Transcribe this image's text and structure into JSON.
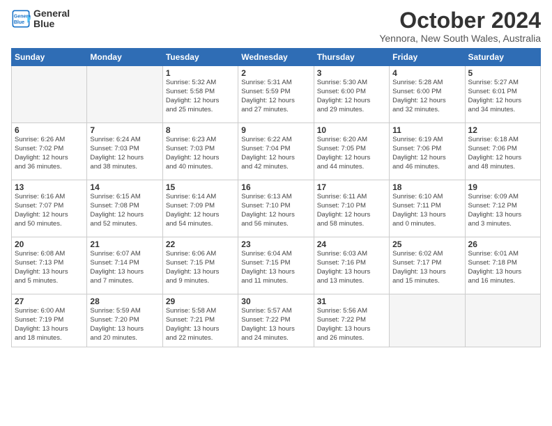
{
  "logo": {
    "line1": "General",
    "line2": "Blue"
  },
  "title": "October 2024",
  "location": "Yennora, New South Wales, Australia",
  "days_of_week": [
    "Sunday",
    "Monday",
    "Tuesday",
    "Wednesday",
    "Thursday",
    "Friday",
    "Saturday"
  ],
  "weeks": [
    [
      {
        "day": "",
        "info": ""
      },
      {
        "day": "",
        "info": ""
      },
      {
        "day": "1",
        "info": "Sunrise: 5:32 AM\nSunset: 5:58 PM\nDaylight: 12 hours\nand 25 minutes."
      },
      {
        "day": "2",
        "info": "Sunrise: 5:31 AM\nSunset: 5:59 PM\nDaylight: 12 hours\nand 27 minutes."
      },
      {
        "day": "3",
        "info": "Sunrise: 5:30 AM\nSunset: 6:00 PM\nDaylight: 12 hours\nand 29 minutes."
      },
      {
        "day": "4",
        "info": "Sunrise: 5:28 AM\nSunset: 6:00 PM\nDaylight: 12 hours\nand 32 minutes."
      },
      {
        "day": "5",
        "info": "Sunrise: 5:27 AM\nSunset: 6:01 PM\nDaylight: 12 hours\nand 34 minutes."
      }
    ],
    [
      {
        "day": "6",
        "info": "Sunrise: 6:26 AM\nSunset: 7:02 PM\nDaylight: 12 hours\nand 36 minutes."
      },
      {
        "day": "7",
        "info": "Sunrise: 6:24 AM\nSunset: 7:03 PM\nDaylight: 12 hours\nand 38 minutes."
      },
      {
        "day": "8",
        "info": "Sunrise: 6:23 AM\nSunset: 7:03 PM\nDaylight: 12 hours\nand 40 minutes."
      },
      {
        "day": "9",
        "info": "Sunrise: 6:22 AM\nSunset: 7:04 PM\nDaylight: 12 hours\nand 42 minutes."
      },
      {
        "day": "10",
        "info": "Sunrise: 6:20 AM\nSunset: 7:05 PM\nDaylight: 12 hours\nand 44 minutes."
      },
      {
        "day": "11",
        "info": "Sunrise: 6:19 AM\nSunset: 7:06 PM\nDaylight: 12 hours\nand 46 minutes."
      },
      {
        "day": "12",
        "info": "Sunrise: 6:18 AM\nSunset: 7:06 PM\nDaylight: 12 hours\nand 48 minutes."
      }
    ],
    [
      {
        "day": "13",
        "info": "Sunrise: 6:16 AM\nSunset: 7:07 PM\nDaylight: 12 hours\nand 50 minutes."
      },
      {
        "day": "14",
        "info": "Sunrise: 6:15 AM\nSunset: 7:08 PM\nDaylight: 12 hours\nand 52 minutes."
      },
      {
        "day": "15",
        "info": "Sunrise: 6:14 AM\nSunset: 7:09 PM\nDaylight: 12 hours\nand 54 minutes."
      },
      {
        "day": "16",
        "info": "Sunrise: 6:13 AM\nSunset: 7:10 PM\nDaylight: 12 hours\nand 56 minutes."
      },
      {
        "day": "17",
        "info": "Sunrise: 6:11 AM\nSunset: 7:10 PM\nDaylight: 12 hours\nand 58 minutes."
      },
      {
        "day": "18",
        "info": "Sunrise: 6:10 AM\nSunset: 7:11 PM\nDaylight: 13 hours\nand 0 minutes."
      },
      {
        "day": "19",
        "info": "Sunrise: 6:09 AM\nSunset: 7:12 PM\nDaylight: 13 hours\nand 3 minutes."
      }
    ],
    [
      {
        "day": "20",
        "info": "Sunrise: 6:08 AM\nSunset: 7:13 PM\nDaylight: 13 hours\nand 5 minutes."
      },
      {
        "day": "21",
        "info": "Sunrise: 6:07 AM\nSunset: 7:14 PM\nDaylight: 13 hours\nand 7 minutes."
      },
      {
        "day": "22",
        "info": "Sunrise: 6:06 AM\nSunset: 7:15 PM\nDaylight: 13 hours\nand 9 minutes."
      },
      {
        "day": "23",
        "info": "Sunrise: 6:04 AM\nSunset: 7:15 PM\nDaylight: 13 hours\nand 11 minutes."
      },
      {
        "day": "24",
        "info": "Sunrise: 6:03 AM\nSunset: 7:16 PM\nDaylight: 13 hours\nand 13 minutes."
      },
      {
        "day": "25",
        "info": "Sunrise: 6:02 AM\nSunset: 7:17 PM\nDaylight: 13 hours\nand 15 minutes."
      },
      {
        "day": "26",
        "info": "Sunrise: 6:01 AM\nSunset: 7:18 PM\nDaylight: 13 hours\nand 16 minutes."
      }
    ],
    [
      {
        "day": "27",
        "info": "Sunrise: 6:00 AM\nSunset: 7:19 PM\nDaylight: 13 hours\nand 18 minutes."
      },
      {
        "day": "28",
        "info": "Sunrise: 5:59 AM\nSunset: 7:20 PM\nDaylight: 13 hours\nand 20 minutes."
      },
      {
        "day": "29",
        "info": "Sunrise: 5:58 AM\nSunset: 7:21 PM\nDaylight: 13 hours\nand 22 minutes."
      },
      {
        "day": "30",
        "info": "Sunrise: 5:57 AM\nSunset: 7:22 PM\nDaylight: 13 hours\nand 24 minutes."
      },
      {
        "day": "31",
        "info": "Sunrise: 5:56 AM\nSunset: 7:22 PM\nDaylight: 13 hours\nand 26 minutes."
      },
      {
        "day": "",
        "info": ""
      },
      {
        "day": "",
        "info": ""
      }
    ]
  ]
}
